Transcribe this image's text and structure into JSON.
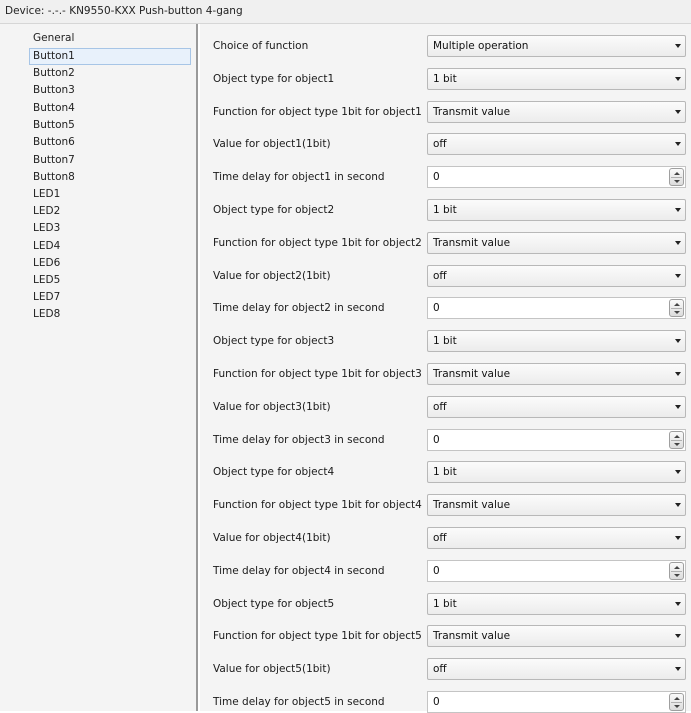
{
  "window": {
    "device_label": "Device:",
    "device_path": "-.-.- ",
    "device_name": "KN9550-KXX Push-button 4-gang"
  },
  "sidebar": {
    "items": [
      {
        "label": "General",
        "selected": false
      },
      {
        "label": "Button1",
        "selected": true
      },
      {
        "label": "Button2",
        "selected": false
      },
      {
        "label": "Button3",
        "selected": false
      },
      {
        "label": "Button4",
        "selected": false
      },
      {
        "label": "Button5",
        "selected": false
      },
      {
        "label": "Button6",
        "selected": false
      },
      {
        "label": "Button7",
        "selected": false
      },
      {
        "label": "Button8",
        "selected": false
      },
      {
        "label": "LED1",
        "selected": false
      },
      {
        "label": "LED2",
        "selected": false
      },
      {
        "label": "LED3",
        "selected": false
      },
      {
        "label": "LED4",
        "selected": false
      },
      {
        "label": "LED6",
        "selected": false
      },
      {
        "label": "LED5",
        "selected": false
      },
      {
        "label": "LED7",
        "selected": false
      },
      {
        "label": "LED8",
        "selected": false
      }
    ]
  },
  "params": [
    {
      "label": "Choice of function",
      "type": "select",
      "value": "Multiple operation"
    },
    {
      "label": "Object type for object1",
      "type": "select",
      "value": "1 bit"
    },
    {
      "label": "Function for object type 1bit for object1",
      "type": "select",
      "value": "Transmit value"
    },
    {
      "label": "Value for object1(1bit)",
      "type": "select",
      "value": "off"
    },
    {
      "label": "Time delay for object1 in second",
      "type": "spin",
      "value": "0"
    },
    {
      "label": "Object type for object2",
      "type": "select",
      "value": "1 bit"
    },
    {
      "label": "Function for object type 1bit for object2",
      "type": "select",
      "value": "Transmit value"
    },
    {
      "label": "Value for object2(1bit)",
      "type": "select",
      "value": "off"
    },
    {
      "label": "Time delay for object2 in second",
      "type": "spin",
      "value": "0"
    },
    {
      "label": "Object type for object3",
      "type": "select",
      "value": "1 bit"
    },
    {
      "label": "Function for object type 1bit for object3",
      "type": "select",
      "value": "Transmit value"
    },
    {
      "label": "Value for object3(1bit)",
      "type": "select",
      "value": "off"
    },
    {
      "label": "Time delay for object3 in second",
      "type": "spin",
      "value": "0"
    },
    {
      "label": "Object type for object4",
      "type": "select",
      "value": "1 bit"
    },
    {
      "label": "Function for object type 1bit for object4",
      "type": "select",
      "value": "Transmit value"
    },
    {
      "label": "Value for object4(1bit)",
      "type": "select",
      "value": "off"
    },
    {
      "label": "Time delay for object4 in second",
      "type": "spin",
      "value": "0"
    },
    {
      "label": "Object type for object5",
      "type": "select",
      "value": "1 bit"
    },
    {
      "label": "Function for object type 1bit for object5",
      "type": "select",
      "value": "Transmit value"
    },
    {
      "label": "Value for object5(1bit)",
      "type": "select",
      "value": "off"
    },
    {
      "label": "Time delay for object5 in second",
      "type": "spin",
      "value": "0"
    }
  ],
  "icons": {
    "dropdown": "chevron-down-icon",
    "spinner": "spin-up-down-icon"
  }
}
